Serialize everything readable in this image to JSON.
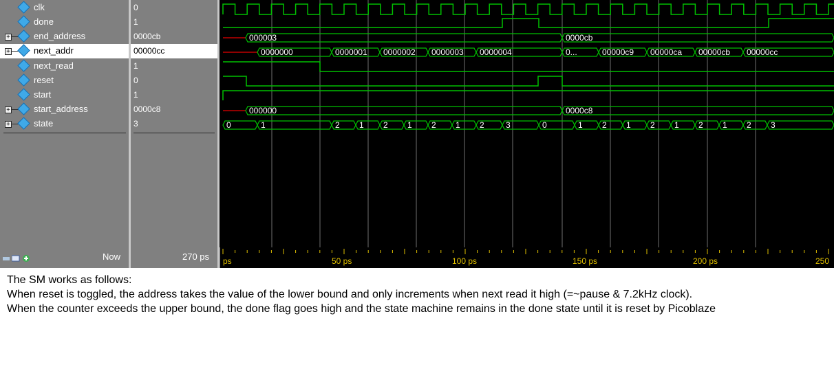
{
  "signals": [
    {
      "name": "clk",
      "value": "0",
      "expandable": false
    },
    {
      "name": "done",
      "value": "1",
      "expandable": false
    },
    {
      "name": "end_address",
      "value": "0000cb",
      "expandable": true
    },
    {
      "name": "next_addr",
      "value": "00000cc",
      "expandable": true,
      "selected": true
    },
    {
      "name": "next_read",
      "value": "1",
      "expandable": false
    },
    {
      "name": "reset",
      "value": "0",
      "expandable": false
    },
    {
      "name": "start",
      "value": "1",
      "expandable": false
    },
    {
      "name": "start_address",
      "value": "0000c8",
      "expandable": true
    },
    {
      "name": "state",
      "value": "3",
      "expandable": true
    }
  ],
  "now_label": "Now",
  "now_value": "270 ps",
  "time_axis": {
    "labels": [
      "ps",
      "50 ps",
      "100 ps",
      "150 ps",
      "200 ps",
      "250"
    ]
  },
  "bus_values": {
    "end_address": [
      "000003",
      "0000cb"
    ],
    "next_addr": [
      "0000000",
      "0000001",
      "0000002",
      "0000003",
      "0000004",
      "0...",
      "00000c9",
      "00000ca",
      "00000cb",
      "00000cc"
    ],
    "start_address": [
      "000000",
      "0000c8"
    ],
    "state": [
      "0",
      "1",
      "2",
      "1",
      "2",
      "1",
      "2",
      "1",
      "2",
      "3",
      "0",
      "1",
      "2",
      "1",
      "2",
      "1",
      "2",
      "1",
      "2",
      "3"
    ]
  },
  "caption": {
    "line1": "The SM works as follows:",
    "line2": "When reset is toggled, the address takes the value of the lower bound and only increments when next read it high (=~pause & 7.2kHz clock).",
    "line3": "When the counter exceeds the upper bound, the done flag goes high and the state machine remains in the done state until it is reset by Picoblaze"
  },
  "colors": {
    "wave": "#00c000",
    "reset_hi": "#00c000",
    "undefined": "#c00000",
    "cursor_lines": "#808080",
    "axis_text": "#e0c000"
  }
}
